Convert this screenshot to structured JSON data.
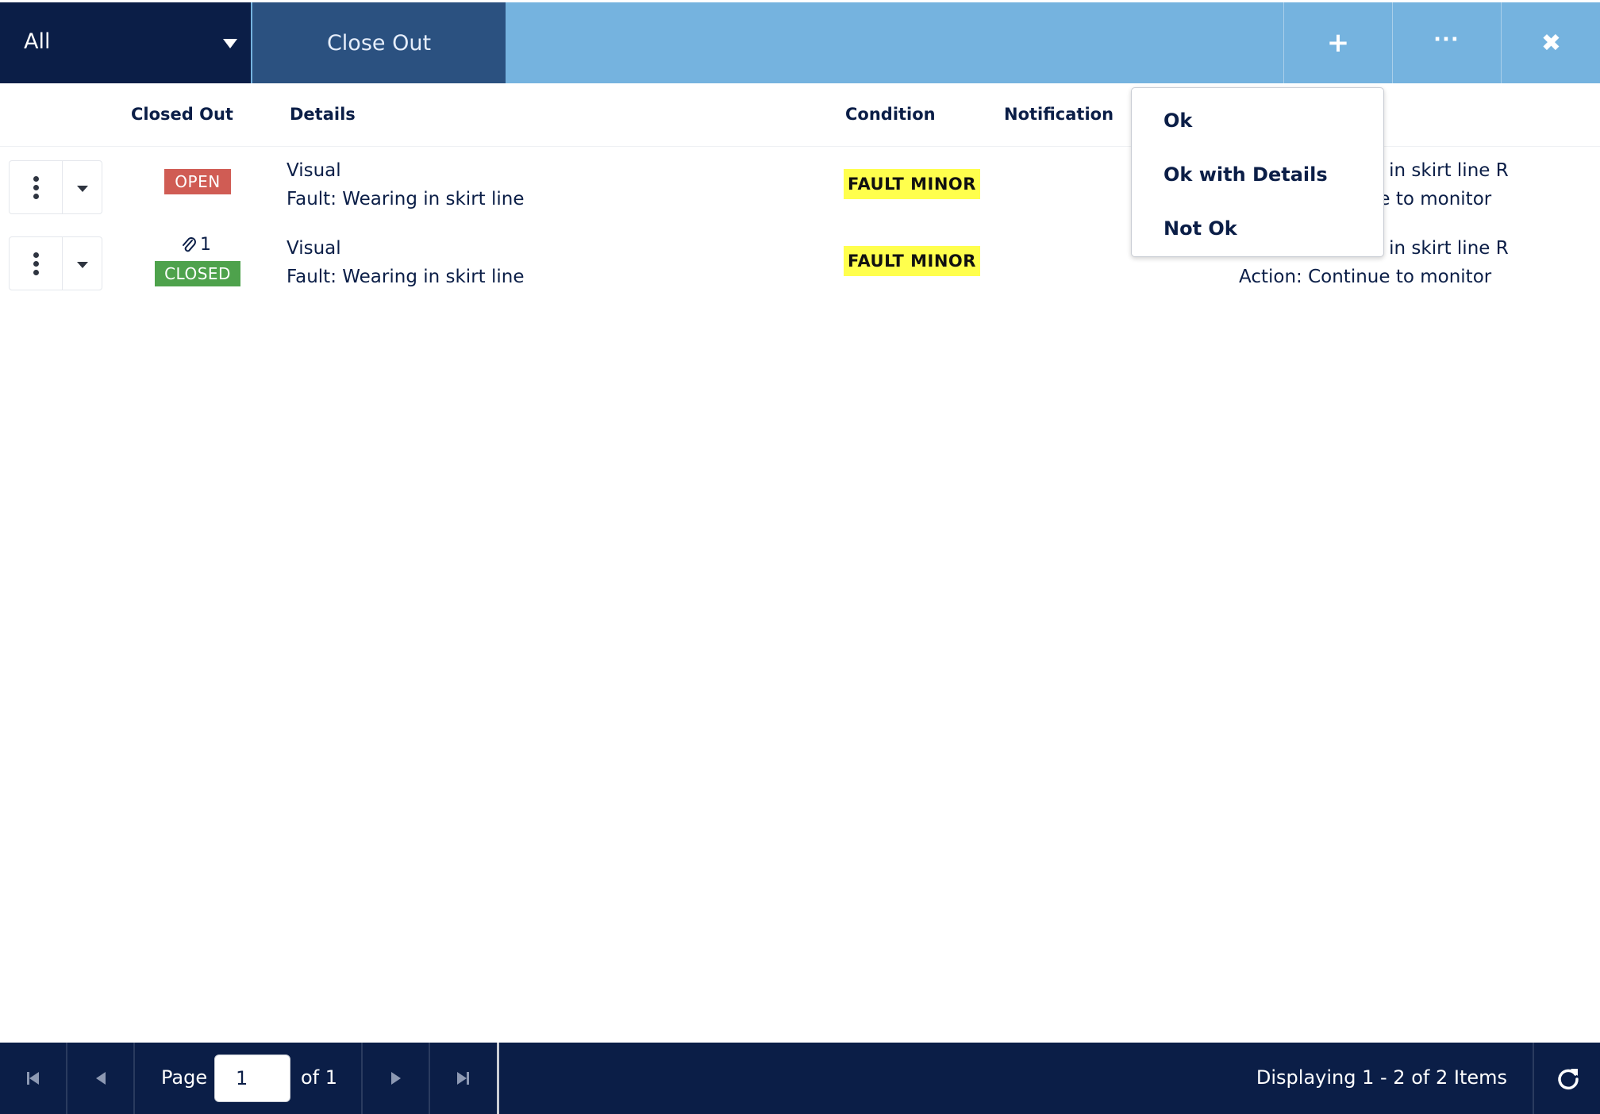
{
  "toolbar": {
    "filter_value": "All",
    "close_out_label": "Close Out",
    "add_icon": "+",
    "more_icon": "···",
    "close_icon": "✖"
  },
  "columns": {
    "closed_out": "Closed Out",
    "details": "Details",
    "condition": "Condition",
    "notification": "Notification"
  },
  "rows": [
    {
      "status": "OPEN",
      "attachments": "",
      "details_line1": "Visual",
      "details_line2": "Fault: Wearing in skirt line",
      "condition": "FAULT MINOR",
      "comment_line1": "Continued wear in skirt line R",
      "comment_line2": "Action: Continue to monitor"
    },
    {
      "status": "CLOSED",
      "attachments": "1",
      "details_line1": "Visual",
      "details_line2": "Fault: Wearing in skirt line",
      "condition": "FAULT MINOR",
      "comment_line1": "Continued wear in skirt line R",
      "comment_line2": "Action: Continue to monitor"
    }
  ],
  "close_out_menu": {
    "items": [
      "Ok",
      "Ok with Details",
      "Not Ok"
    ]
  },
  "pager": {
    "page_label": "Page",
    "page_value": "1",
    "of_label": "of 1",
    "display_text": "Displaying 1 - 2 of 2 Items"
  },
  "colors": {
    "navy": "#0b1e47",
    "toolbar_blue": "#75b3df",
    "close_out_blue": "#2b5180",
    "open_red": "#d05c54",
    "closed_green": "#4ea24c",
    "fault_yellow": "#ffff4d"
  }
}
